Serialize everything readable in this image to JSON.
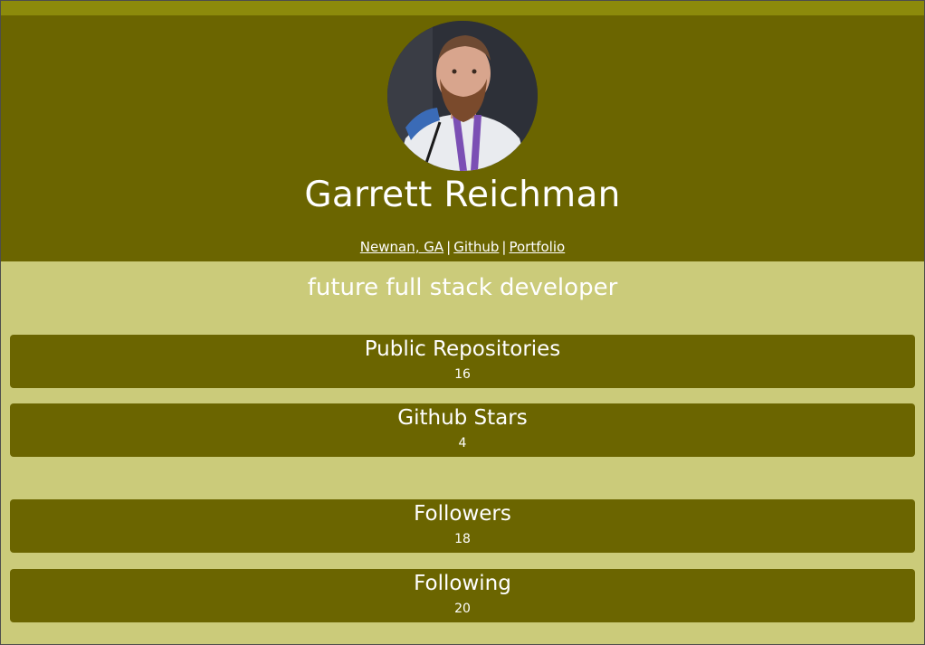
{
  "profile": {
    "name": "Garrett Reichman",
    "location": "Newnan, GA",
    "github_link": "Github",
    "portfolio_link": "Portfolio",
    "separator": "|",
    "tagline": "future full stack developer"
  },
  "stats": [
    {
      "label": "Public Repositories",
      "value": "16"
    },
    {
      "label": "Github Stars",
      "value": "4"
    },
    {
      "label": "Followers",
      "value": "18"
    },
    {
      "label": "Following",
      "value": "20"
    }
  ],
  "colors": {
    "top_strip": "#8c8a0b",
    "header_bg": "#6b6500",
    "page_bg": "#cbcb7a",
    "card_bg": "#6b6500",
    "text": "#ffffff"
  }
}
